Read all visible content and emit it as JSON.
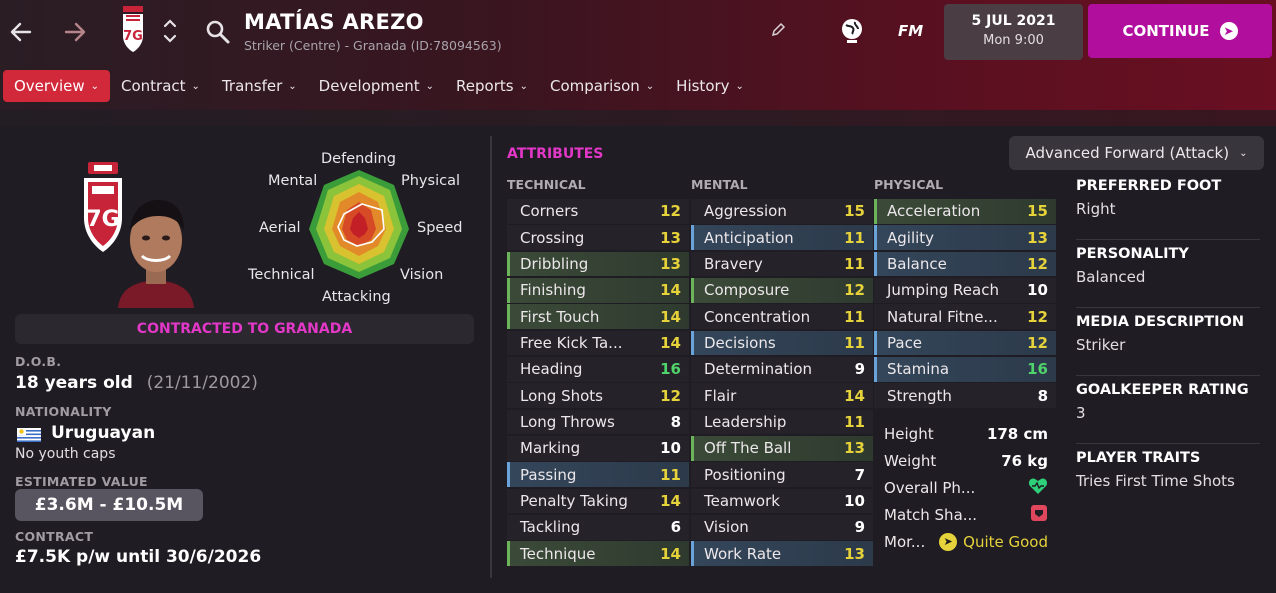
{
  "header": {
    "player_name": "MATÍAS AREZO",
    "player_subtitle": "Striker (Centre) - Granada (ID:78094563)",
    "date": "5 JUL 2021",
    "time": "Mon 9:00",
    "fm_label": "FM",
    "continue_label": "CONTINUE"
  },
  "tabs": [
    {
      "label": "Overview",
      "active": true
    },
    {
      "label": "Contract"
    },
    {
      "label": "Transfer"
    },
    {
      "label": "Development"
    },
    {
      "label": "Reports"
    },
    {
      "label": "Comparison"
    },
    {
      "label": "History"
    }
  ],
  "radar": {
    "labels": [
      "Defending",
      "Physical",
      "Speed",
      "Vision",
      "Attacking",
      "Technical",
      "Aerial",
      "Mental"
    ]
  },
  "profile": {
    "contract_status": "CONTRACTED TO GRANADA",
    "dob_label": "D.O.B.",
    "age": "18 years old",
    "dob": "(21/11/2002)",
    "nationality_label": "NATIONALITY",
    "nationality": "Uruguayan",
    "youth_caps": "No youth caps",
    "value_label": "ESTIMATED VALUE",
    "value": "£3.6M - £10.5M",
    "contract_label": "CONTRACT",
    "contract": "£7.5K p/w until 30/6/2026"
  },
  "attributes": {
    "title": "ATTRIBUTES",
    "role": "Advanced Forward (Attack)",
    "technical_label": "TECHNICAL",
    "mental_label": "MENTAL",
    "physical_label": "PHYSICAL",
    "technical": [
      {
        "name": "Corners",
        "value": "12",
        "tone": "y",
        "hl": ""
      },
      {
        "name": "Crossing",
        "value": "13",
        "tone": "y",
        "hl": ""
      },
      {
        "name": "Dribbling",
        "value": "13",
        "tone": "y",
        "hl": "green"
      },
      {
        "name": "Finishing",
        "value": "14",
        "tone": "y",
        "hl": "green"
      },
      {
        "name": "First Touch",
        "value": "14",
        "tone": "y",
        "hl": "green"
      },
      {
        "name": "Free Kick Ta...",
        "value": "14",
        "tone": "y",
        "hl": ""
      },
      {
        "name": "Heading",
        "value": "16",
        "tone": "g",
        "hl": ""
      },
      {
        "name": "Long Shots",
        "value": "12",
        "tone": "y",
        "hl": ""
      },
      {
        "name": "Long Throws",
        "value": "8",
        "tone": "w",
        "hl": ""
      },
      {
        "name": "Marking",
        "value": "10",
        "tone": "w",
        "hl": ""
      },
      {
        "name": "Passing",
        "value": "11",
        "tone": "y",
        "hl": "blue"
      },
      {
        "name": "Penalty Taking",
        "value": "14",
        "tone": "y",
        "hl": ""
      },
      {
        "name": "Tackling",
        "value": "6",
        "tone": "w",
        "hl": ""
      },
      {
        "name": "Technique",
        "value": "14",
        "tone": "y",
        "hl": "green"
      }
    ],
    "mental": [
      {
        "name": "Aggression",
        "value": "15",
        "tone": "y",
        "hl": ""
      },
      {
        "name": "Anticipation",
        "value": "11",
        "tone": "y",
        "hl": "blue"
      },
      {
        "name": "Bravery",
        "value": "11",
        "tone": "y",
        "hl": ""
      },
      {
        "name": "Composure",
        "value": "12",
        "tone": "y",
        "hl": "green"
      },
      {
        "name": "Concentration",
        "value": "11",
        "tone": "y",
        "hl": ""
      },
      {
        "name": "Decisions",
        "value": "11",
        "tone": "y",
        "hl": "blue"
      },
      {
        "name": "Determination",
        "value": "9",
        "tone": "w",
        "hl": ""
      },
      {
        "name": "Flair",
        "value": "14",
        "tone": "y",
        "hl": ""
      },
      {
        "name": "Leadership",
        "value": "11",
        "tone": "y",
        "hl": ""
      },
      {
        "name": "Off The Ball",
        "value": "13",
        "tone": "y",
        "hl": "green"
      },
      {
        "name": "Positioning",
        "value": "7",
        "tone": "w",
        "hl": ""
      },
      {
        "name": "Teamwork",
        "value": "10",
        "tone": "w",
        "hl": ""
      },
      {
        "name": "Vision",
        "value": "9",
        "tone": "w",
        "hl": ""
      },
      {
        "name": "Work Rate",
        "value": "13",
        "tone": "y",
        "hl": "blue"
      }
    ],
    "physical": [
      {
        "name": "Acceleration",
        "value": "15",
        "tone": "y",
        "hl": "green"
      },
      {
        "name": "Agility",
        "value": "13",
        "tone": "y",
        "hl": "blue"
      },
      {
        "name": "Balance",
        "value": "12",
        "tone": "y",
        "hl": "blue"
      },
      {
        "name": "Jumping Reach",
        "value": "10",
        "tone": "w",
        "hl": ""
      },
      {
        "name": "Natural Fitne...",
        "value": "12",
        "tone": "y",
        "hl": ""
      },
      {
        "name": "Pace",
        "value": "12",
        "tone": "y",
        "hl": "blue"
      },
      {
        "name": "Stamina",
        "value": "16",
        "tone": "g",
        "hl": "blue"
      },
      {
        "name": "Strength",
        "value": "8",
        "tone": "w",
        "hl": ""
      }
    ],
    "height_label": "Height",
    "height": "178 cm",
    "weight_label": "Weight",
    "weight": "76 kg",
    "overall_label": "Overall Ph...",
    "match_label": "Match Sha...",
    "morale_label": "Mor...",
    "morale": "Quite Good"
  },
  "info": {
    "foot_label": "PREFERRED FOOT",
    "foot": "Right",
    "personality_label": "PERSONALITY",
    "personality": "Balanced",
    "media_label": "MEDIA DESCRIPTION",
    "media": "Striker",
    "gk_label": "GOALKEEPER RATING",
    "gk": "3",
    "traits_label": "PLAYER TRAITS",
    "traits": "Tries First Time Shots"
  },
  "colors": {
    "accent_magenta": "#e338c7",
    "continue_button": "#b10e9e",
    "active_tab": "#d1283a",
    "value_good": "#e6d23a",
    "value_excellent": "#4fd36a"
  }
}
